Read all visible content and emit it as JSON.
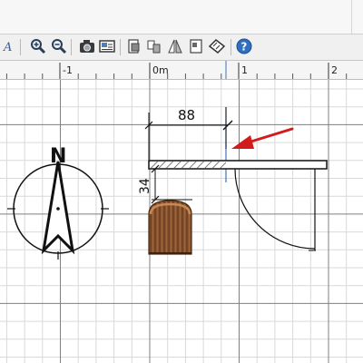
{
  "toolbar": {
    "icons": [
      "text-style-icon",
      "zoom-in-icon",
      "zoom-out-icon",
      "camera-icon",
      "photo-icon",
      "import-furniture-icon",
      "export-icon",
      "flip-icon",
      "page-setup-icon",
      "measure-icon",
      "help-icon"
    ]
  },
  "ruler": {
    "labels": [
      "-1",
      "0m",
      "1",
      "2"
    ]
  },
  "plan": {
    "compass_label": "N",
    "dimension_width": "88",
    "dimension_height": "34"
  },
  "colors": {
    "grid_major": "#7f7f7f",
    "grid_minor": "#d9d9d9",
    "selection": "#3d73b8",
    "arrow": "#d21c1c",
    "wood": "#7a4a26"
  }
}
